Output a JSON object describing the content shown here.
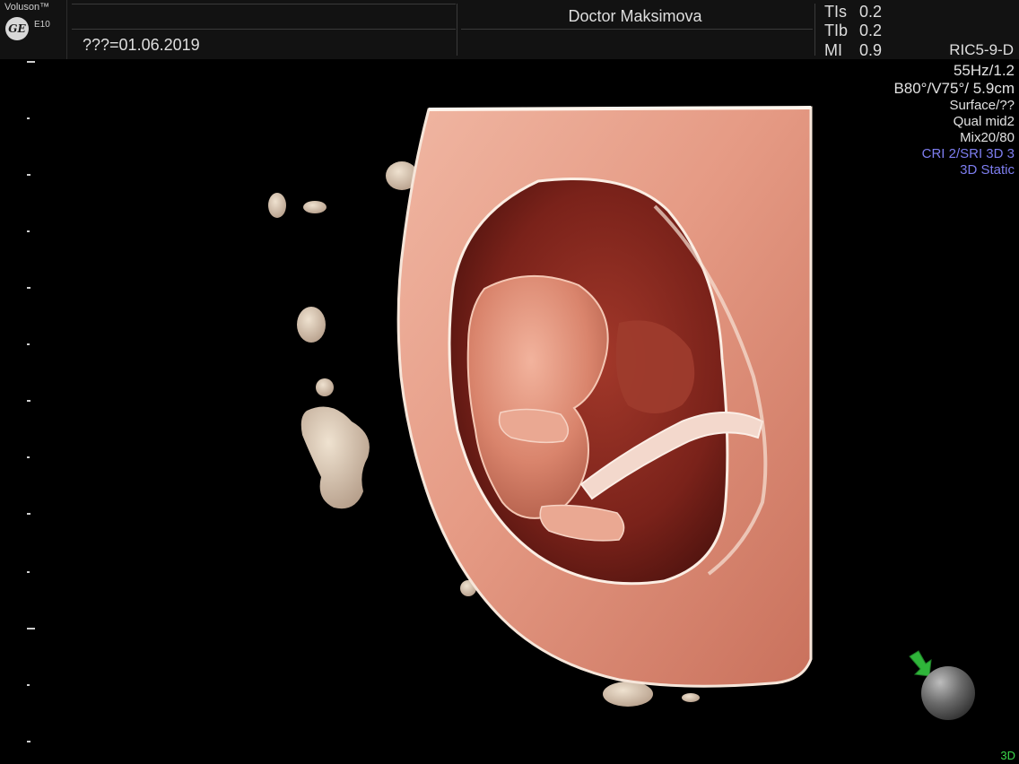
{
  "header": {
    "brand": "Voluson™",
    "logo": "GE",
    "model": "E10",
    "date": "???=01.06.2019",
    "doctor": "Doctor Maksimova",
    "ti": [
      {
        "label": "TIs",
        "value": "0.2"
      },
      {
        "label": "TIb",
        "value": "0.2"
      },
      {
        "label": "MI",
        "value": "0.9"
      }
    ]
  },
  "params": {
    "probe": "RIC5-9-D",
    "lines": [
      "55Hz/1.2",
      "B80°/V75°/ 5.9cm",
      "Surface/??",
      "Qual mid2",
      "Mix20/80",
      "CRI 2/SRI 3D 3",
      "3D Static"
    ]
  },
  "mode": "3D",
  "colors": {
    "background": "#000000",
    "header": "#121212",
    "text": "#dedede",
    "blue_param": "#7e7ef0",
    "mode_green": "#3bd84a",
    "render_flesh": "#e9a592",
    "render_cavity": "#8a2a20"
  },
  "icons": [
    "ge-logo-icon",
    "orientation-arrow-icon",
    "orientation-ball-icon"
  ]
}
